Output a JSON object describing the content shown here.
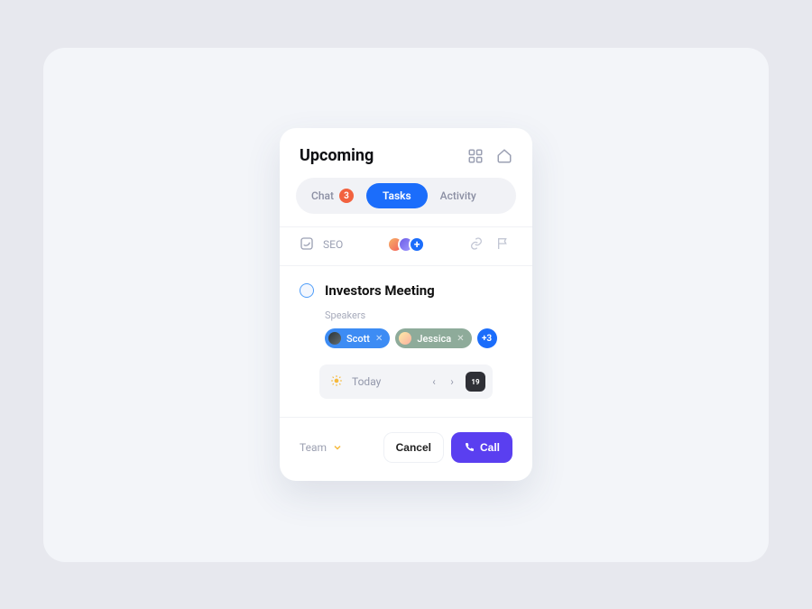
{
  "header": {
    "title": "Upcoming"
  },
  "tabs": {
    "chat": {
      "label": "Chat",
      "badge": "3"
    },
    "tasks": {
      "label": "Tasks"
    },
    "activity": {
      "label": "Activity"
    }
  },
  "seo": {
    "label": "SEO",
    "add": "+"
  },
  "task": {
    "title": "Investors Meeting",
    "speakers_label": "Speakers",
    "chips": {
      "scott": "Scott",
      "jessica": "Jessica",
      "more": "+3"
    }
  },
  "date": {
    "label": "Today",
    "day": "19"
  },
  "footer": {
    "team": "Team",
    "cancel": "Cancel",
    "call": "Call"
  }
}
